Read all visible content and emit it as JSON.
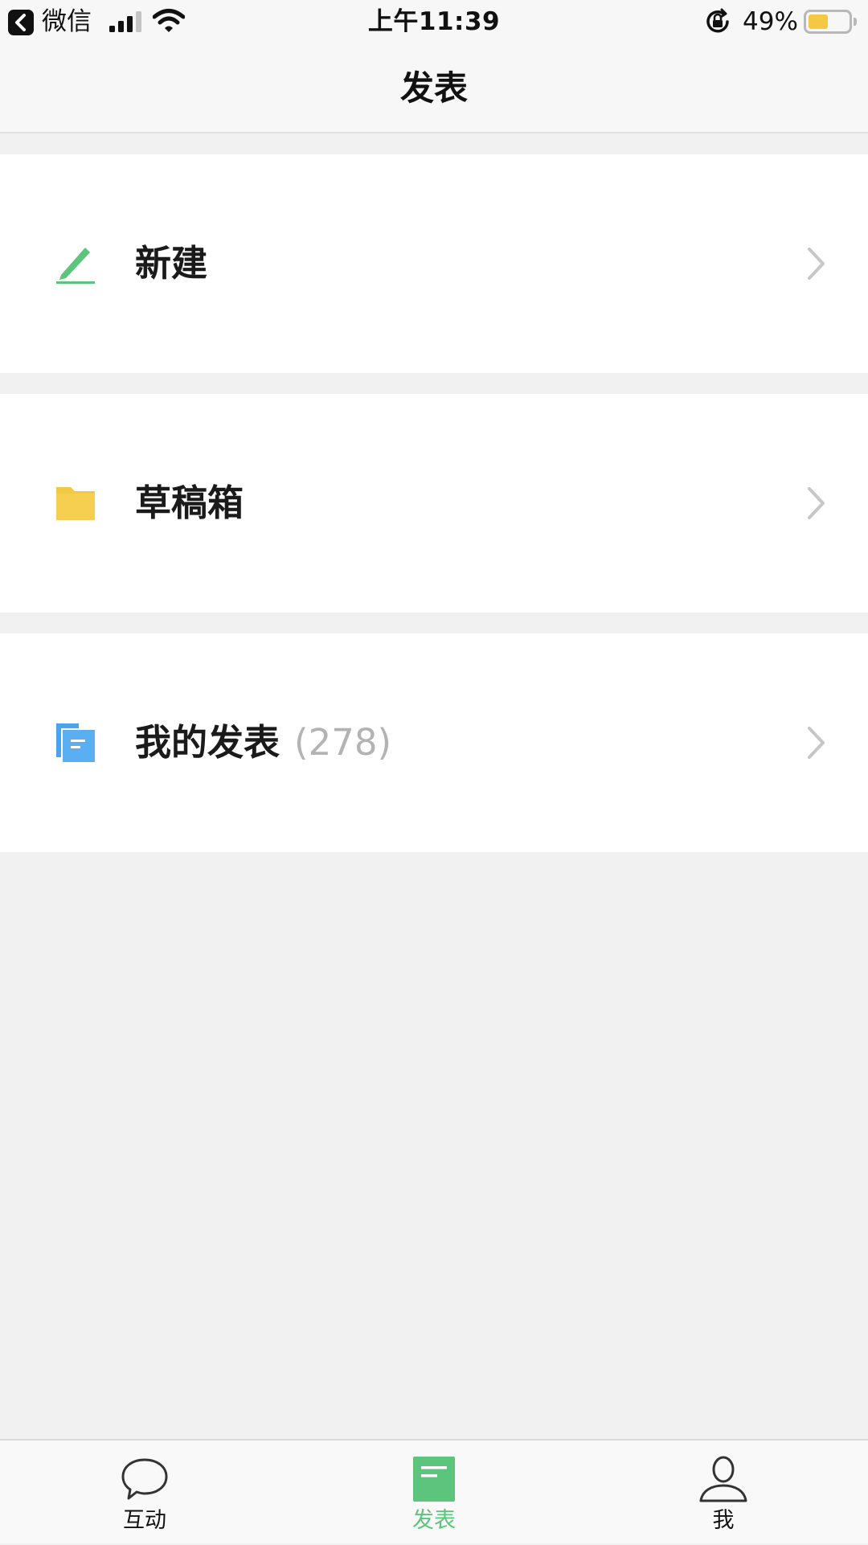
{
  "status_bar": {
    "back_app": "微信",
    "time": "上午11:39",
    "battery_percent": "49%",
    "battery_level": 0.49
  },
  "header": {
    "title": "发表"
  },
  "menu": [
    {
      "label": "新建",
      "count": "",
      "icon": "pencil-icon",
      "color": "#5cc47c"
    },
    {
      "label": "草稿箱",
      "count": "",
      "icon": "folder-icon",
      "color": "#f5c843"
    },
    {
      "label": "我的发表",
      "count": "(278)",
      "icon": "documents-icon",
      "color": "#4aa3ef"
    }
  ],
  "tabbar": {
    "active_color": "#5cc47c",
    "tabs": [
      {
        "label": "互动",
        "icon": "chat-bubble-icon"
      },
      {
        "label": "发表",
        "icon": "document-icon",
        "active": true
      },
      {
        "label": "我",
        "icon": "person-icon"
      }
    ]
  }
}
